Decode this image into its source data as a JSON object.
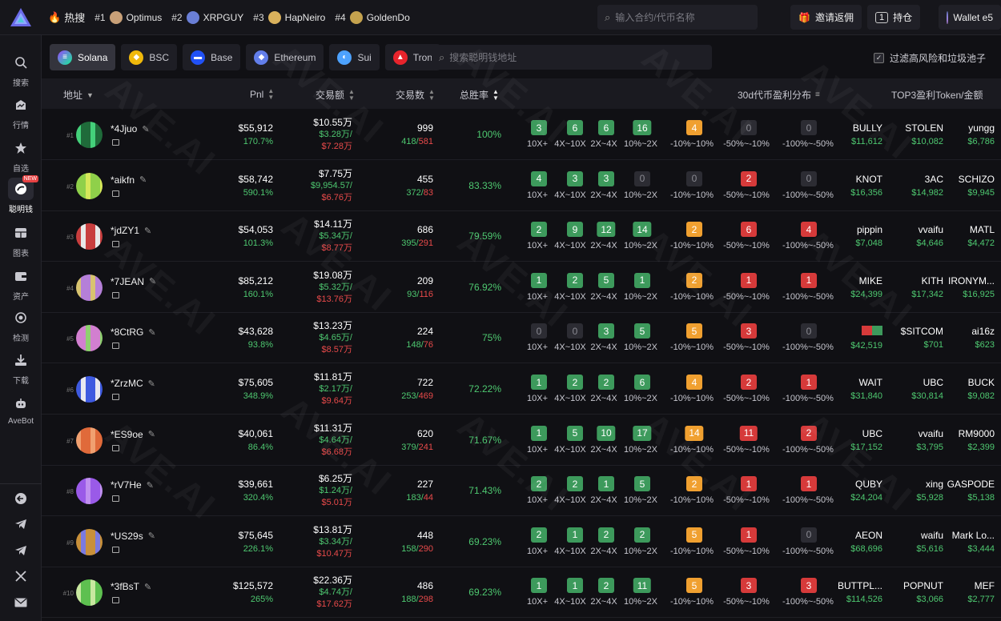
{
  "topbar": {
    "hot_label": "热搜",
    "hot_items": [
      {
        "rank": "#1",
        "name": "Optimus",
        "color": "#c8a078"
      },
      {
        "rank": "#2",
        "name": "XRPGUY",
        "color": "#6a7fd6"
      },
      {
        "rank": "#3",
        "name": "HapNeiro",
        "color": "#d9b15c"
      },
      {
        "rank": "#4",
        "name": "GoldenDo",
        "color": "#c4a24e"
      }
    ],
    "search_placeholder": "输入合约/代币名称",
    "invite_label": "邀请返佣",
    "positions_count": "1",
    "positions_label": "持仓",
    "wallet_label": "Wallet e5"
  },
  "sidebar": {
    "items": [
      {
        "label": "搜索",
        "icon": "search-icon"
      },
      {
        "label": "行情",
        "icon": "market-icon"
      },
      {
        "label": "自选",
        "icon": "star-icon"
      },
      {
        "label": "聪明钱",
        "icon": "smart-money-icon",
        "badge": "NEW"
      },
      {
        "label": "图表",
        "icon": "chart-icon"
      },
      {
        "label": "资产",
        "icon": "wallet-icon"
      },
      {
        "label": "检测",
        "icon": "detect-icon"
      },
      {
        "label": "下载",
        "icon": "download-icon"
      },
      {
        "label": "AveBot",
        "icon": "bot-icon"
      }
    ]
  },
  "chains": [
    {
      "label": "Solana",
      "color": "#1c1c24",
      "glyph": "≡"
    },
    {
      "label": "BSC",
      "color": "#f0b90b",
      "glyph": "◆"
    },
    {
      "label": "Base",
      "color": "#2151f5",
      "glyph": "▬"
    },
    {
      "label": "Ethereum",
      "color": "#627eea",
      "glyph": "◆"
    },
    {
      "label": "Sui",
      "color": "#4da2ff",
      "glyph": "◐"
    },
    {
      "label": "Tron",
      "color": "#e8242c",
      "glyph": "▲"
    }
  ],
  "smart_search_placeholder": "搜索聪明钱地址",
  "filter_label": "过滤高风险和垃圾池子",
  "headers": {
    "address": "地址",
    "pnl": "Pnl",
    "volume": "交易额",
    "count": "交易数",
    "winrate": "总胜率",
    "dist": "30d代币盈利分布",
    "top3": "TOP3盈利Token/金额"
  },
  "dist_labels": [
    "10X+",
    "4X~10X",
    "2X~4X",
    "10%~2X",
    "-10%~10%",
    "-50%~-10%",
    "-100%~-50%"
  ],
  "rows": [
    {
      "rank": "#1",
      "name": "*4Jjuo",
      "pnl": "$55,912",
      "pnl_pct": "170.7%",
      "vol": "$10.55万",
      "buy": "$3.28万/",
      "sell": "$7.28万",
      "count": "999",
      "win": "418",
      "lose": "581",
      "winrate": "100%",
      "dist": [
        "3",
        "6",
        "6",
        "16",
        "4",
        "0",
        "0"
      ],
      "tokens": [
        {
          "n": "BULLY",
          "a": "$11,612"
        },
        {
          "n": "STOLEN",
          "a": "$10,082"
        },
        {
          "n": "yungg",
          "a": "$6,786"
        }
      ],
      "av": [
        "#1f6b3a",
        "#44d07a"
      ]
    },
    {
      "rank": "#2",
      "name": "*aikfn",
      "pnl": "$58,742",
      "pnl_pct": "590.1%",
      "vol": "$7.75万",
      "buy": "$9,954.57/",
      "sell": "$6.76万",
      "count": "455",
      "win": "372",
      "lose": "83",
      "winrate": "83.33%",
      "dist": [
        "4",
        "3",
        "3",
        "0",
        "0",
        "2",
        "0"
      ],
      "tokens": [
        {
          "n": "KNOT",
          "a": "$16,356"
        },
        {
          "n": "3AC",
          "a": "$14,982"
        },
        {
          "n": "SCHIZO",
          "a": "$9,945"
        }
      ],
      "av": [
        "#8fd04a",
        "#d6e85a"
      ]
    },
    {
      "rank": "#3",
      "name": "*jdZY1",
      "pnl": "$54,053",
      "pnl_pct": "101.3%",
      "vol": "$14.11万",
      "buy": "$5.34万/",
      "sell": "$8.77万",
      "count": "686",
      "win": "395",
      "lose": "291",
      "winrate": "79.59%",
      "dist": [
        "2",
        "9",
        "12",
        "14",
        "2",
        "6",
        "4"
      ],
      "tokens": [
        {
          "n": "pippin",
          "a": "$7,048"
        },
        {
          "n": "vvaifu",
          "a": "$4,646"
        },
        {
          "n": "MATL",
          "a": "$4,472"
        }
      ],
      "av": [
        "#c83e3e",
        "#e8e8e8"
      ]
    },
    {
      "rank": "#4",
      "name": "*7JEAN",
      "pnl": "$85,212",
      "pnl_pct": "160.1%",
      "vol": "$19.08万",
      "buy": "$5.32万/",
      "sell": "$13.76万",
      "count": "209",
      "win": "93",
      "lose": "116",
      "winrate": "76.92%",
      "dist": [
        "1",
        "2",
        "5",
        "1",
        "2",
        "1",
        "1"
      ],
      "tokens": [
        {
          "n": "MIKE",
          "a": "$24,399"
        },
        {
          "n": "KITH",
          "a": "$17,342"
        },
        {
          "n": "IRONYM...",
          "a": "$16,925"
        }
      ],
      "av": [
        "#b57fd8",
        "#d8c470"
      ]
    },
    {
      "rank": "#5",
      "name": "*8CtRG",
      "pnl": "$43,628",
      "pnl_pct": "93.8%",
      "vol": "$13.23万",
      "buy": "$4.65万/",
      "sell": "$8.57万",
      "count": "224",
      "win": "148",
      "lose": "76",
      "winrate": "75%",
      "dist": [
        "0",
        "0",
        "3",
        "5",
        "5",
        "3",
        "0"
      ],
      "tokens": [
        {
          "n": "",
          "a": "$42,519",
          "flag": true
        },
        {
          "n": "$SITCOM",
          "a": "$701"
        },
        {
          "n": "ai16z",
          "a": "$623"
        }
      ],
      "av": [
        "#d27fd0",
        "#8fd070"
      ]
    },
    {
      "rank": "#6",
      "name": "*ZrzMC",
      "pnl": "$75,605",
      "pnl_pct": "348.9%",
      "vol": "$11.81万",
      "buy": "$2.17万/",
      "sell": "$9.64万",
      "count": "722",
      "win": "253",
      "lose": "469",
      "winrate": "72.22%",
      "dist": [
        "1",
        "2",
        "2",
        "6",
        "4",
        "2",
        "1"
      ],
      "tokens": [
        {
          "n": "WAIT",
          "a": "$31,840"
        },
        {
          "n": "UBC",
          "a": "$30,814"
        },
        {
          "n": "BUCK",
          "a": "$9,082"
        }
      ],
      "av": [
        "#3e5ae0",
        "#e8e8f0"
      ]
    },
    {
      "rank": "#7",
      "name": "*ES9oe",
      "pnl": "$40,061",
      "pnl_pct": "86.4%",
      "vol": "$11.31万",
      "buy": "$4.64万/",
      "sell": "$6.68万",
      "count": "620",
      "win": "379",
      "lose": "241",
      "winrate": "71.67%",
      "dist": [
        "1",
        "5",
        "10",
        "17",
        "14",
        "11",
        "2"
      ],
      "tokens": [
        {
          "n": "UBC",
          "a": "$17,152"
        },
        {
          "n": "vvaifu",
          "a": "$3,795"
        },
        {
          "n": "RM9000",
          "a": "$2,399"
        }
      ],
      "av": [
        "#e06a3a",
        "#f0a070"
      ]
    },
    {
      "rank": "#8",
      "name": "*rV7He",
      "pnl": "$39,661",
      "pnl_pct": "320.4%",
      "vol": "$6.25万",
      "buy": "$1.24万/",
      "sell": "$5.01万",
      "count": "227",
      "win": "183",
      "lose": "44",
      "winrate": "71.43%",
      "dist": [
        "2",
        "2",
        "1",
        "5",
        "2",
        "1",
        "1"
      ],
      "tokens": [
        {
          "n": "QUBY",
          "a": "$24,204"
        },
        {
          "n": "xing",
          "a": "$5,928"
        },
        {
          "n": "GASPODE",
          "a": "$5,138"
        }
      ],
      "av": [
        "#9a5ae8",
        "#c090f0"
      ]
    },
    {
      "rank": "#9",
      "name": "*US29s",
      "pnl": "$75,645",
      "pnl_pct": "226.1%",
      "vol": "$13.81万",
      "buy": "$3.34万/",
      "sell": "$10.47万",
      "count": "448",
      "win": "158",
      "lose": "290",
      "winrate": "69.23%",
      "dist": [
        "2",
        "1",
        "2",
        "2",
        "5",
        "1",
        "0"
      ],
      "tokens": [
        {
          "n": "AEON",
          "a": "$68,696"
        },
        {
          "n": "waifu",
          "a": "$5,616"
        },
        {
          "n": "Mark Lo...",
          "a": "$3,444"
        }
      ],
      "av": [
        "#c8903a",
        "#7a7ae0"
      ]
    },
    {
      "rank": "#10",
      "name": "*3fBsT",
      "pnl": "$125,572",
      "pnl_pct": "265%",
      "vol": "$22.36万",
      "buy": "$4.74万/",
      "sell": "$17.62万",
      "count": "486",
      "win": "188",
      "lose": "298",
      "winrate": "69.23%",
      "dist": [
        "1",
        "1",
        "2",
        "11",
        "5",
        "3",
        "3"
      ],
      "tokens": [
        {
          "n": "BUTTPL...",
          "a": "$114,526"
        },
        {
          "n": "POPNUT",
          "a": "$3,066"
        },
        {
          "n": "MEF",
          "a": "$2,777"
        }
      ],
      "av": [
        "#5ec050",
        "#c8e8a0"
      ]
    }
  ],
  "colors": {
    "green_box": "#3d9a5c",
    "orange_box": "#f0a030",
    "red_box": "#d63a3a",
    "zero_box": "#2c2c33",
    "profit": "#4ec870",
    "loss": "#e84a4a"
  },
  "watermark": "AVE.AI"
}
